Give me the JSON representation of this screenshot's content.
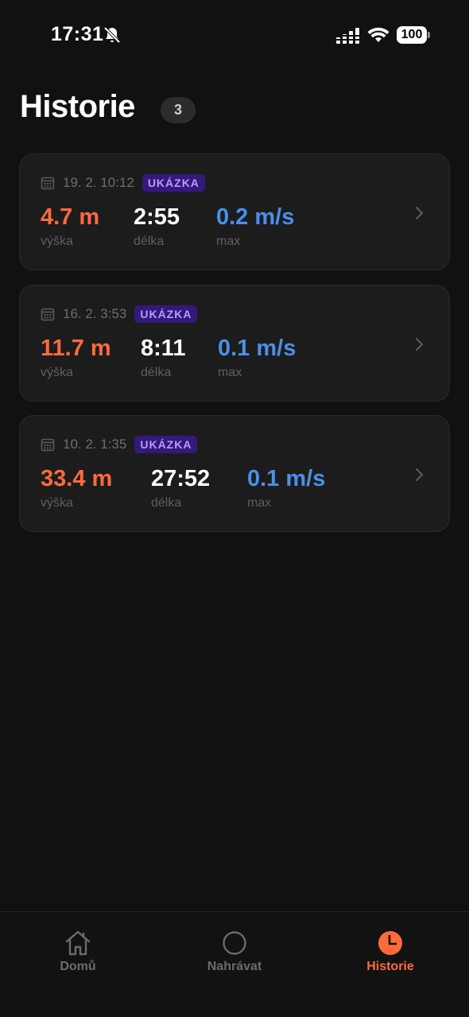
{
  "status_bar": {
    "time": "17:31",
    "battery": "100"
  },
  "header": {
    "title": "Historie",
    "count": "3"
  },
  "cards": [
    {
      "date": "19. 2. 10:12",
      "badge": "UKÁZKA",
      "height_value": "4.7 m",
      "height_label": "výška",
      "duration_value": "2:55",
      "duration_label": "délka",
      "max_value": "0.2 m/s",
      "max_label": "max"
    },
    {
      "date": "16. 2. 3:53",
      "badge": "UKÁZKA",
      "height_value": "11.7 m",
      "height_label": "výška",
      "duration_value": "8:11",
      "duration_label": "délka",
      "max_value": "0.1 m/s",
      "max_label": "max"
    },
    {
      "date": "10. 2. 1:35",
      "badge": "UKÁZKA",
      "height_value": "33.4 m",
      "height_label": "výška",
      "duration_value": "27:52",
      "duration_label": "délka",
      "max_value": "0.1 m/s",
      "max_label": "max"
    }
  ],
  "tab_bar": {
    "home": "Domů",
    "record": "Nahrávat",
    "history": "Historie",
    "active": "history"
  },
  "colors": {
    "accent": "#ff6a3d",
    "speed": "#4a90e8",
    "badge_bg": "#35197a",
    "badge_text": "#b59cff",
    "background": "#111111"
  },
  "icons": {
    "status": [
      "bell-slash-icon",
      "signal-icon",
      "wifi-icon",
      "battery-icon"
    ],
    "card": [
      "calendar-icon",
      "chevron-right-icon"
    ],
    "tabs": [
      "home-icon",
      "record-circle-icon",
      "clock-icon"
    ]
  }
}
